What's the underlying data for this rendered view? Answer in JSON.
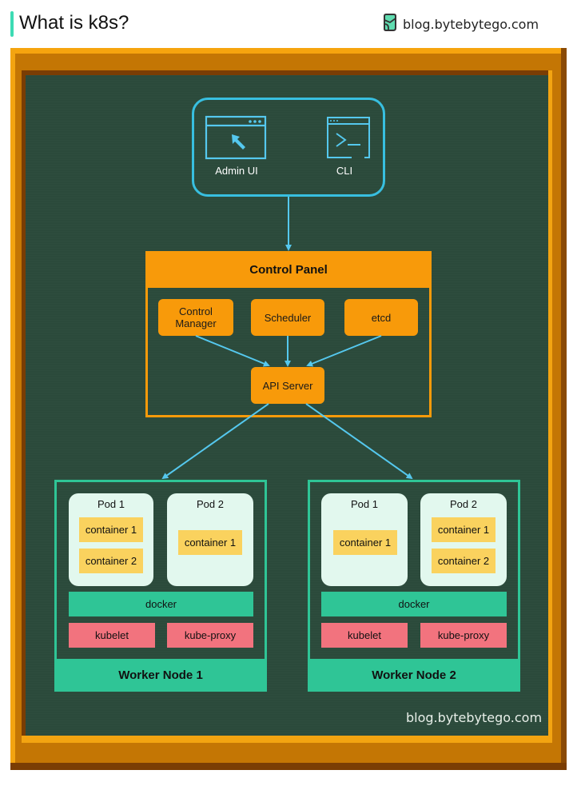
{
  "header": {
    "title": "What is k8s?",
    "brand": "blog.bytebytego.com",
    "accent_color": "#3ddbb4"
  },
  "board": {
    "watermark": "blog.bytebytego.com"
  },
  "clients": {
    "admin_ui": "Admin UI",
    "cli": "CLI"
  },
  "control_panel": {
    "title": "Control Panel",
    "control_manager": "Control Manager",
    "scheduler": "Scheduler",
    "etcd": "etcd",
    "api_server": "API Server"
  },
  "worker_nodes": [
    {
      "title": "Worker Node 1",
      "pods": [
        {
          "title": "Pod 1",
          "containers": [
            "container 1",
            "container 2"
          ]
        },
        {
          "title": "Pod 2",
          "containers": [
            "container 1"
          ]
        }
      ],
      "runtime": "docker",
      "kubelet": "kubelet",
      "kube_proxy": "kube-proxy"
    },
    {
      "title": "Worker Node 2",
      "pods": [
        {
          "title": "Pod 1",
          "containers": [
            "container 1"
          ]
        },
        {
          "title": "Pod 2",
          "containers": [
            "container 1",
            "container 2"
          ]
        }
      ],
      "runtime": "docker",
      "kubelet": "kubelet",
      "kube_proxy": "kube-proxy"
    }
  ],
  "colors": {
    "frame_orange": "#c47604",
    "board_green": "#2b4a3b",
    "client_blue": "#38bfe0",
    "control_orange": "#f89a0a",
    "node_green": "#2fc596",
    "pod_bg": "#e2f8ee",
    "container_yellow": "#fad25e",
    "agent_pink": "#f2737e",
    "arrow_blue": "#55c8ee"
  }
}
